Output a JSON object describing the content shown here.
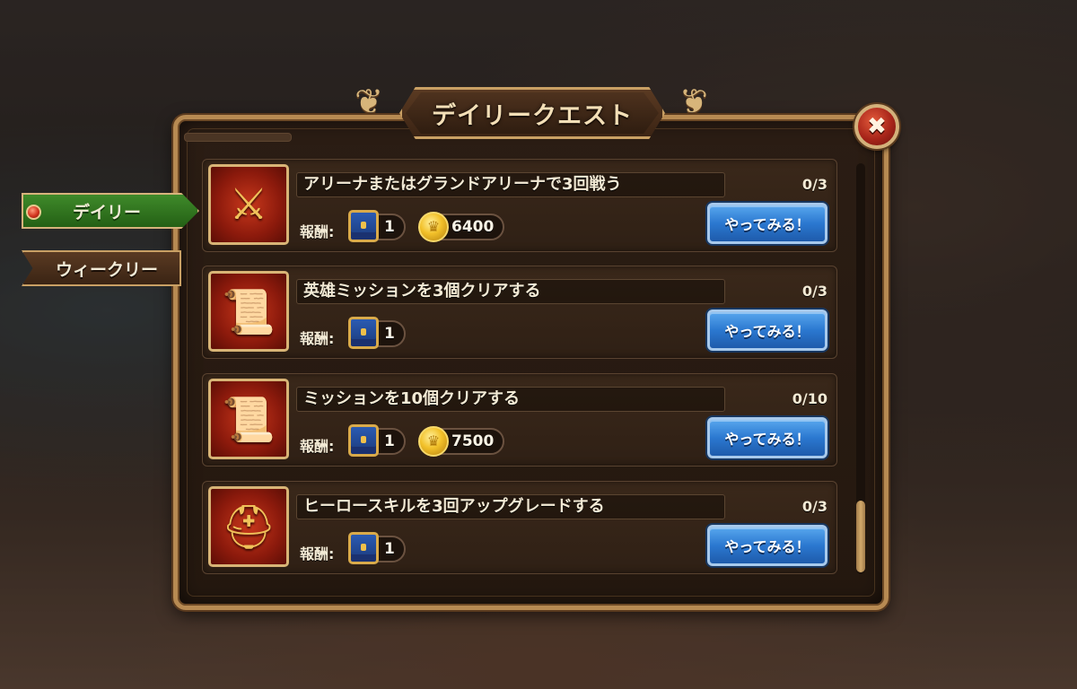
{
  "window": {
    "title": "デイリークエスト",
    "close_icon": "close-x-icon"
  },
  "tabs": [
    {
      "label": "デイリー",
      "active": true
    },
    {
      "label": "ウィークリー",
      "active": false
    }
  ],
  "quests": [
    {
      "title": "アリーナまたはグランドアリーナで3回戦う",
      "progress": "0/3",
      "reward_label": "報酬:",
      "icon": "crossed-swords-icon",
      "chest_count": "1",
      "coins": "6400",
      "button": "やってみる！"
    },
    {
      "title": "英雄ミッションを3個クリアする",
      "progress": "0/3",
      "reward_label": "報酬:",
      "icon": "scroll-map-icon",
      "chest_count": "1",
      "coins": null,
      "button": "やってみる！"
    },
    {
      "title": "ミッションを10個クリアする",
      "progress": "0/10",
      "reward_label": "報酬:",
      "icon": "scroll-map-icon",
      "chest_count": "1",
      "coins": "7500",
      "button": "やってみる！"
    },
    {
      "title": "ヒーロースキルを3回アップグレードする",
      "progress": "0/3",
      "reward_label": "報酬:",
      "icon": "winged-helmet-icon",
      "chest_count": "1",
      "coins": null,
      "button": "やってみる！"
    }
  ],
  "colors": {
    "accent_green": "#2f7a1f",
    "button_blue": "#2b78d0",
    "frame_gold": "#c9a064"
  }
}
